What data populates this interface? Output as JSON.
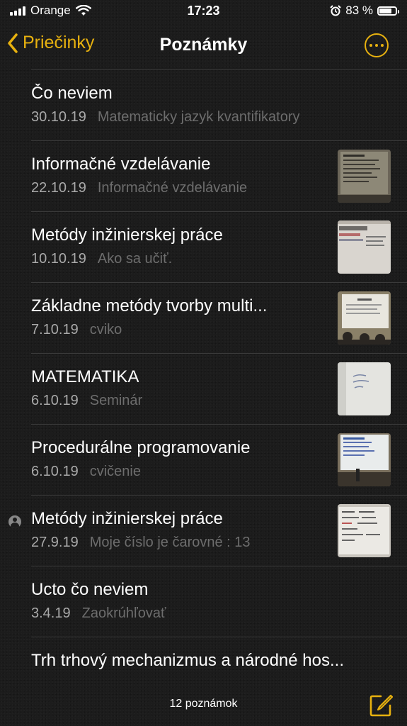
{
  "status_bar": {
    "carrier": "Orange",
    "time": "17:23",
    "battery": "83 %",
    "battery_level": 0.83
  },
  "nav": {
    "back_label": "Priečinky",
    "title": "Poznámky"
  },
  "notes": [
    {
      "title": "Čo neviem",
      "date": "30.10.19",
      "preview": "Matematicky jazyk kvantifikatory"
    },
    {
      "title": "Informačné vzdelávanie",
      "date": "22.10.19",
      "preview": "Informačné vzdelávanie"
    },
    {
      "title": "Metódy inžinierskej práce",
      "date": "10.10.19",
      "preview": "Ako sa učiť."
    },
    {
      "title": "Základne metódy tvorby multi...",
      "date": "7.10.19",
      "preview": "cviko"
    },
    {
      "title": "MATEMATIKA",
      "date": "6.10.19",
      "preview": "Seminár"
    },
    {
      "title": "Procedurálne programovanie",
      "date": "6.10.19",
      "preview": "cvičenie"
    },
    {
      "title": "Metódy inžinierskej práce",
      "date": "27.9.19",
      "preview": "Moje číslo je čarovné : 13"
    },
    {
      "title": "Ucto čo neviem",
      "date": "3.4.19",
      "preview": "Zaokrúhľovať"
    },
    {
      "title": "Trh trhový mechanizmus a národné hos..."
    }
  ],
  "toolbar": {
    "count": "12 poznámok"
  },
  "colors": {
    "accent": "#e7b10f",
    "background": "#1c1c1c"
  }
}
